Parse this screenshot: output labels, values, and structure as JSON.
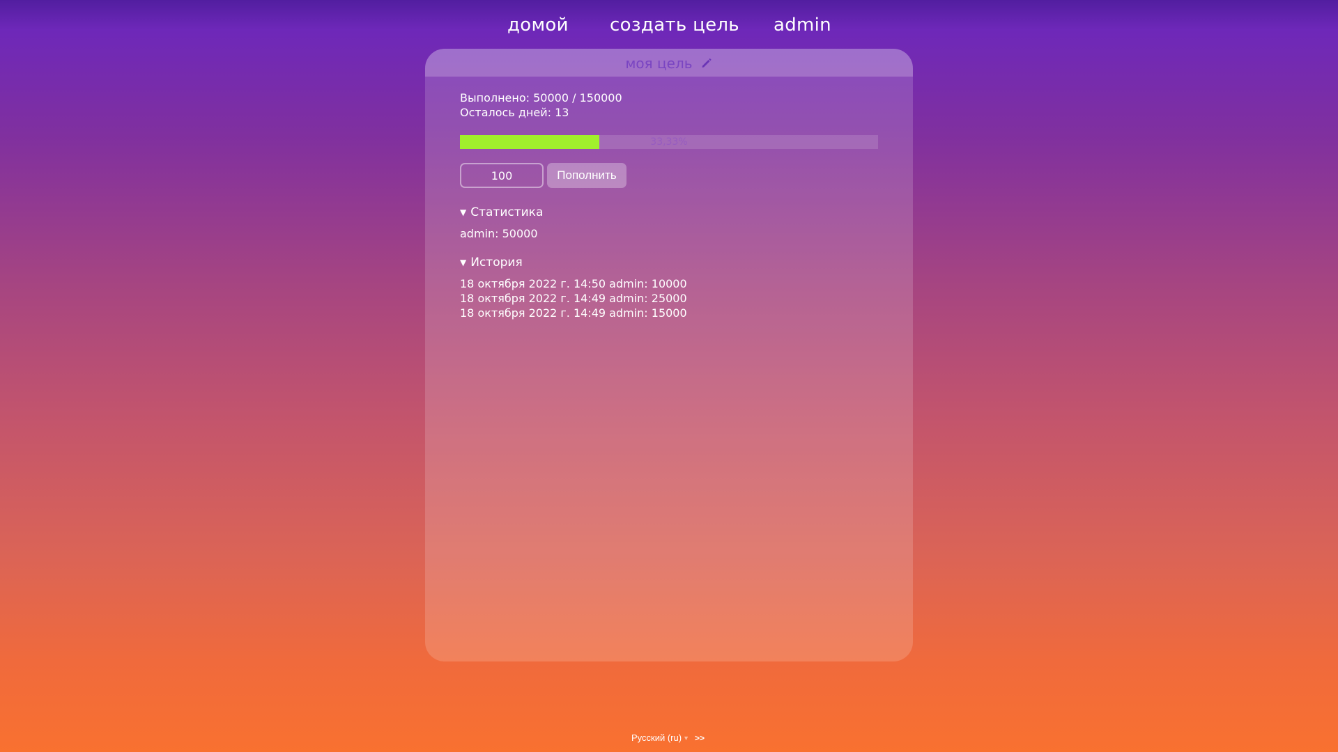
{
  "nav": {
    "home": "домой",
    "create_goal": "создать цель",
    "user": "admin"
  },
  "goal": {
    "title": "моя цель",
    "edit_icon": "pencil-icon",
    "completed_line": "Выполнено: 50000 / 150000",
    "days_left_line": "Осталось дней: 13",
    "progress_fraction": 0.3333,
    "progress_label": "33,33%",
    "progress_color": "#a1f02c",
    "amount_value": "100",
    "topup_label": "Пополнить"
  },
  "statistics": {
    "label": "Статистика",
    "items": [
      "admin: 50000"
    ]
  },
  "history": {
    "label": "История",
    "items": [
      "18 октября 2022 г. 14:50 admin: 10000",
      "18 октября 2022 г. 14:49 admin: 25000",
      "18 октября 2022 г. 14:49 admin: 15000"
    ]
  },
  "footer": {
    "language": "Русский (ru)",
    "go_label": ">>"
  }
}
